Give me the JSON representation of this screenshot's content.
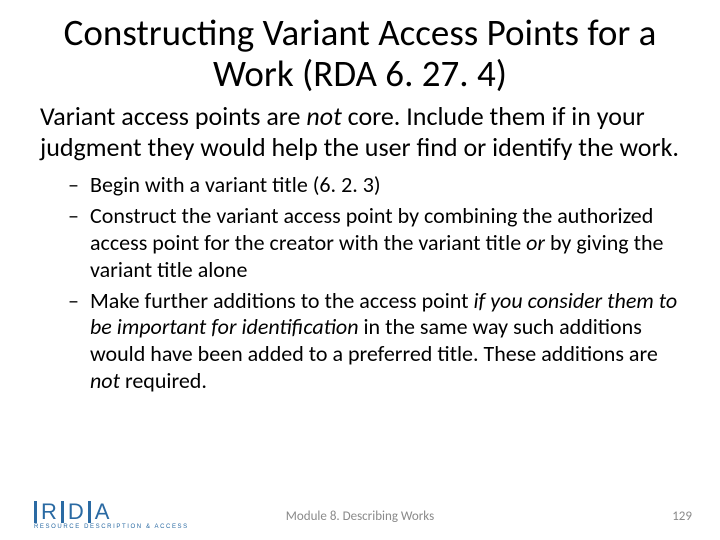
{
  "title": "Constructing Variant Access Points for a Work (RDA 6. 27. 4)",
  "intro": {
    "pre": "Variant access points are ",
    "em": "not",
    "post": " core. Include them if in your judgment they would help the user find or identify the work."
  },
  "bullets": [
    {
      "pre": "Begin with a variant title (6. 2. 3)",
      "em": "",
      "mid": "",
      "post": ""
    },
    {
      "pre": "Construct the variant access point by combining the authorized access point for the creator with the variant title ",
      "em": "or",
      "mid": " by giving the variant title alone",
      "post": ""
    },
    {
      "pre": "Make further additions to the access point ",
      "em": "if you consider them to be important for identification",
      "mid": " in the same way such additions would have been added to a preferred title. These additions are ",
      "em2": "not",
      "post": " required."
    }
  ],
  "logo": {
    "letters": [
      "R",
      "D",
      "A"
    ],
    "sub": "RESOURCE DESCRIPTION & ACCESS"
  },
  "footer": {
    "module": "Module 8. Describing Works",
    "page": "129"
  }
}
